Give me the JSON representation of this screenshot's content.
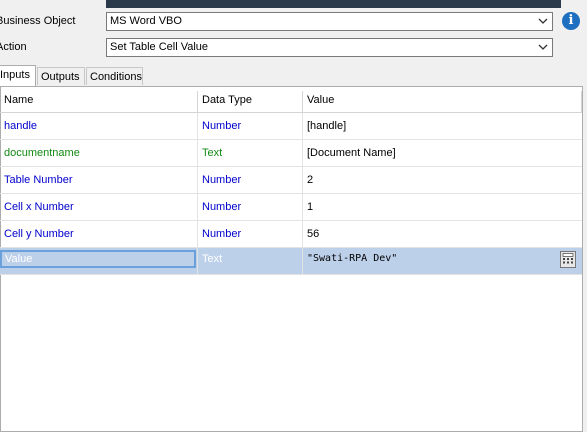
{
  "form": {
    "business_object_label": "Business Object",
    "business_object_value": "MS Word VBO",
    "action_label": "Action",
    "action_value": "Set Table Cell Value"
  },
  "tabs": [
    {
      "label": "Inputs",
      "active": true
    },
    {
      "label": "Outputs",
      "active": false
    },
    {
      "label": "Conditions",
      "active": false
    }
  ],
  "grid": {
    "headers": [
      "Name",
      "Data Type",
      "Value"
    ],
    "rows": [
      {
        "name": "handle",
        "type": "Number",
        "value": "[handle]"
      },
      {
        "name": "documentname",
        "type": "Text",
        "value": "[Document Name]"
      },
      {
        "name": "Table Number",
        "type": "Number",
        "value": "2"
      },
      {
        "name": "Cell x Number",
        "type": "Number",
        "value": "1"
      },
      {
        "name": "Cell y Number",
        "type": "Number",
        "value": "56"
      },
      {
        "name": "Value",
        "type": "Text",
        "value": "\"Swati-RPA Dev\""
      }
    ]
  },
  "colors": {
    "number_type": "#0000cc",
    "text_type": "#138a13",
    "selected_row": "#bdd0ea",
    "info_icon": "#1e6fc0"
  },
  "icons": {
    "dropdown": "chevron-down-icon",
    "info": "info-icon",
    "expression_editor": "calculator-icon"
  }
}
